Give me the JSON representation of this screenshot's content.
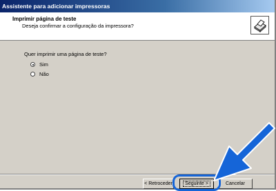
{
  "window": {
    "title": "Assistente para adicionar impressoras"
  },
  "header": {
    "title": "Imprimir página de teste",
    "subtitle": "Deseja confirmar a configuração da impressora?",
    "icon": "printer-icon"
  },
  "content": {
    "question": "Quer imprimir uma página de teste?",
    "options": [
      {
        "label": "Sim",
        "selected": true
      },
      {
        "label": "Não",
        "selected": false
      }
    ]
  },
  "buttons": {
    "back": "< Retroceder",
    "next": "Seguinte >",
    "cancel": "Cancelar"
  },
  "colors": {
    "accent": "#1565d8",
    "title_bar": "#0a246a",
    "dialog_bg": "#d4d0c8"
  }
}
